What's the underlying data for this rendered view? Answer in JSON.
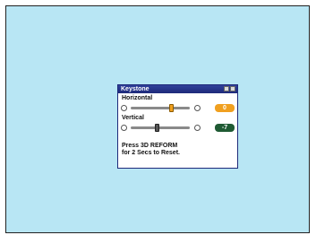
{
  "osd": {
    "title": "Keystone",
    "horizontal": {
      "label": "Horizontal",
      "value": "0",
      "level": 0.7
    },
    "vertical": {
      "label": "Vertical",
      "value": "-7",
      "level": 0.45
    },
    "message_line1": "Press 3D REFORM",
    "message_line2": "for 2 Secs to Reset."
  },
  "colors": {
    "screen_bg": "#b8e6f4",
    "title_bar": "#1e2a7a",
    "active_value": "#f0a020",
    "inactive_value": "#1f5a33"
  }
}
